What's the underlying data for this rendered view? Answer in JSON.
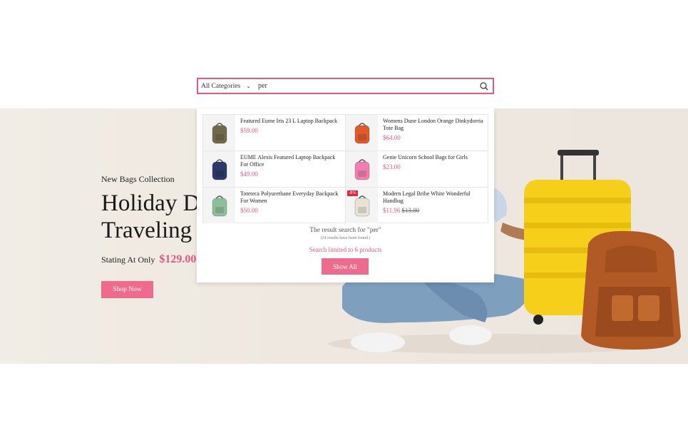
{
  "search": {
    "category": "All Categories",
    "query": "per"
  },
  "hero": {
    "subtitle": "New Bags Collection",
    "title_line1": "Holiday D",
    "title_line2": "Traveling",
    "price_prefix": "Stating At Only",
    "price": "$129.00",
    "button": "Shop Now"
  },
  "results": {
    "products": [
      {
        "name": "Featured Eume Iris 23 L Laptop Backpack",
        "price": "$59.00",
        "old_price": "",
        "badge": "",
        "icon": "green-backpack-icon",
        "color": "#6f6a4a"
      },
      {
        "name": "Womens Dune London Orange Dinkydorria Tote Bag",
        "price": "$64.00",
        "old_price": "",
        "badge": "",
        "icon": "orange-tote-icon",
        "color": "#e05a2a"
      },
      {
        "name": "EUME Alexis Featured Laptop Backpack For Office",
        "price": "$49.00",
        "old_price": "",
        "badge": "",
        "icon": "navy-backpack-icon",
        "color": "#2b3a66"
      },
      {
        "name": "Genie Unicorn School Bags for Girls",
        "price": "$23.00",
        "old_price": "",
        "badge": "",
        "icon": "pink-backpack-icon",
        "color": "#f07fb0"
      },
      {
        "name": "Toteteca Polyurethane Everyday Backpack For Women",
        "price": "$50.00",
        "old_price": "",
        "badge": "",
        "icon": "mint-backpack-icon",
        "color": "#8fbf9a"
      },
      {
        "name": "Modern Legal Bribe White Wonderful Handbag",
        "price": "$11.96",
        "old_price": "$13.00",
        "badge": "-8%",
        "icon": "white-handbag-icon",
        "color": "#e9e3d6"
      }
    ],
    "summary": "The result search for \"per\"",
    "count": "(24 results have been found.)",
    "limit": "Search limited to 6 products",
    "show_all": "Show All"
  }
}
